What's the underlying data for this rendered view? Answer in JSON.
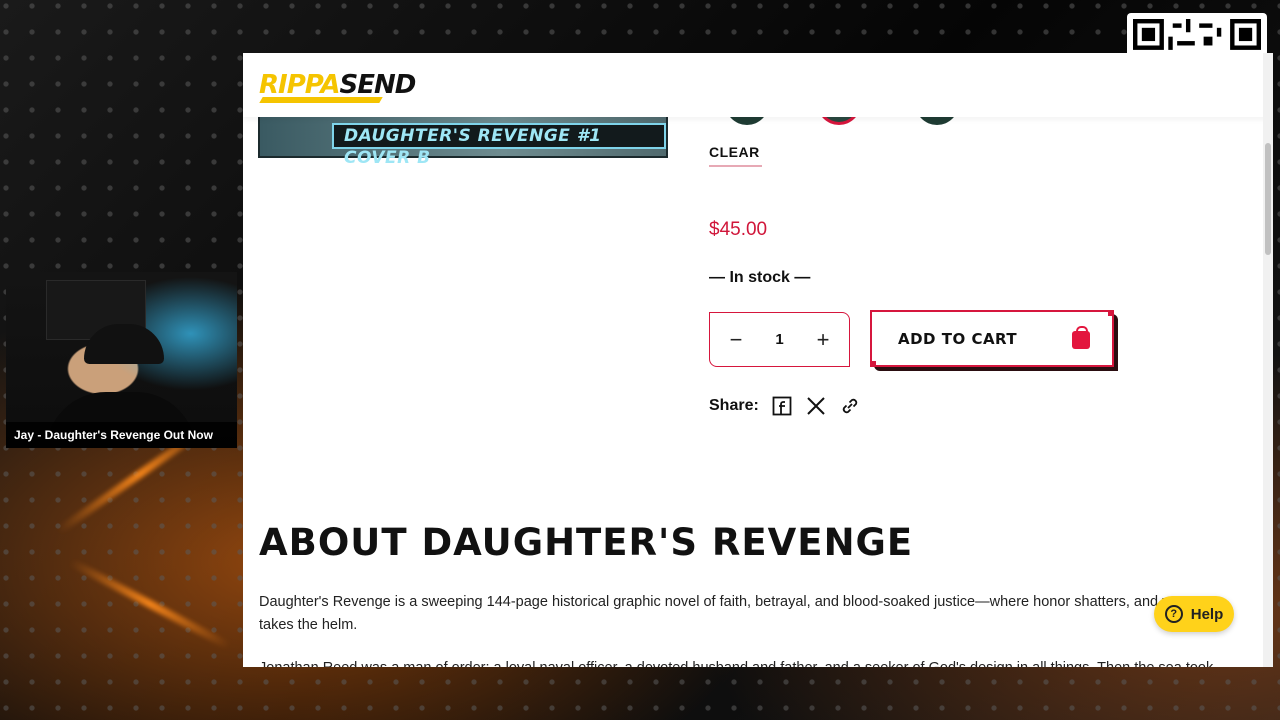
{
  "stream": {
    "webcam_label": "Jay - Daughter's Revenge Out Now"
  },
  "site": {
    "logo_part1": "RIPPA",
    "logo_part2": "SEND"
  },
  "product": {
    "cover_banner": "DAUGHTER'S REVENGE #1 COVER B",
    "clear_label": "CLEAR",
    "price": "$45.00",
    "stock": "— In stock —",
    "quantity": "1",
    "add_to_cart": "ADD TO CART",
    "share_label": "Share:"
  },
  "about": {
    "title": "ABOUT DAUGHTER'S REVENGE",
    "paragraph1": "Daughter's Revenge is a sweeping 144-page historical graphic novel of faith, betrayal, and blood-soaked justice—where honor shatters, and v... takes the helm.",
    "paragraph2": "Jonathan Reed was a man of order: a loyal naval officer, a devoted husband and father, and a seeker of God's design in all things. Then the sea took"
  },
  "widgets": {
    "help": "Help"
  },
  "colors": {
    "accent_red": "#d6163d",
    "brand_yellow": "#f5c400",
    "help_yellow": "#ffd21a"
  }
}
